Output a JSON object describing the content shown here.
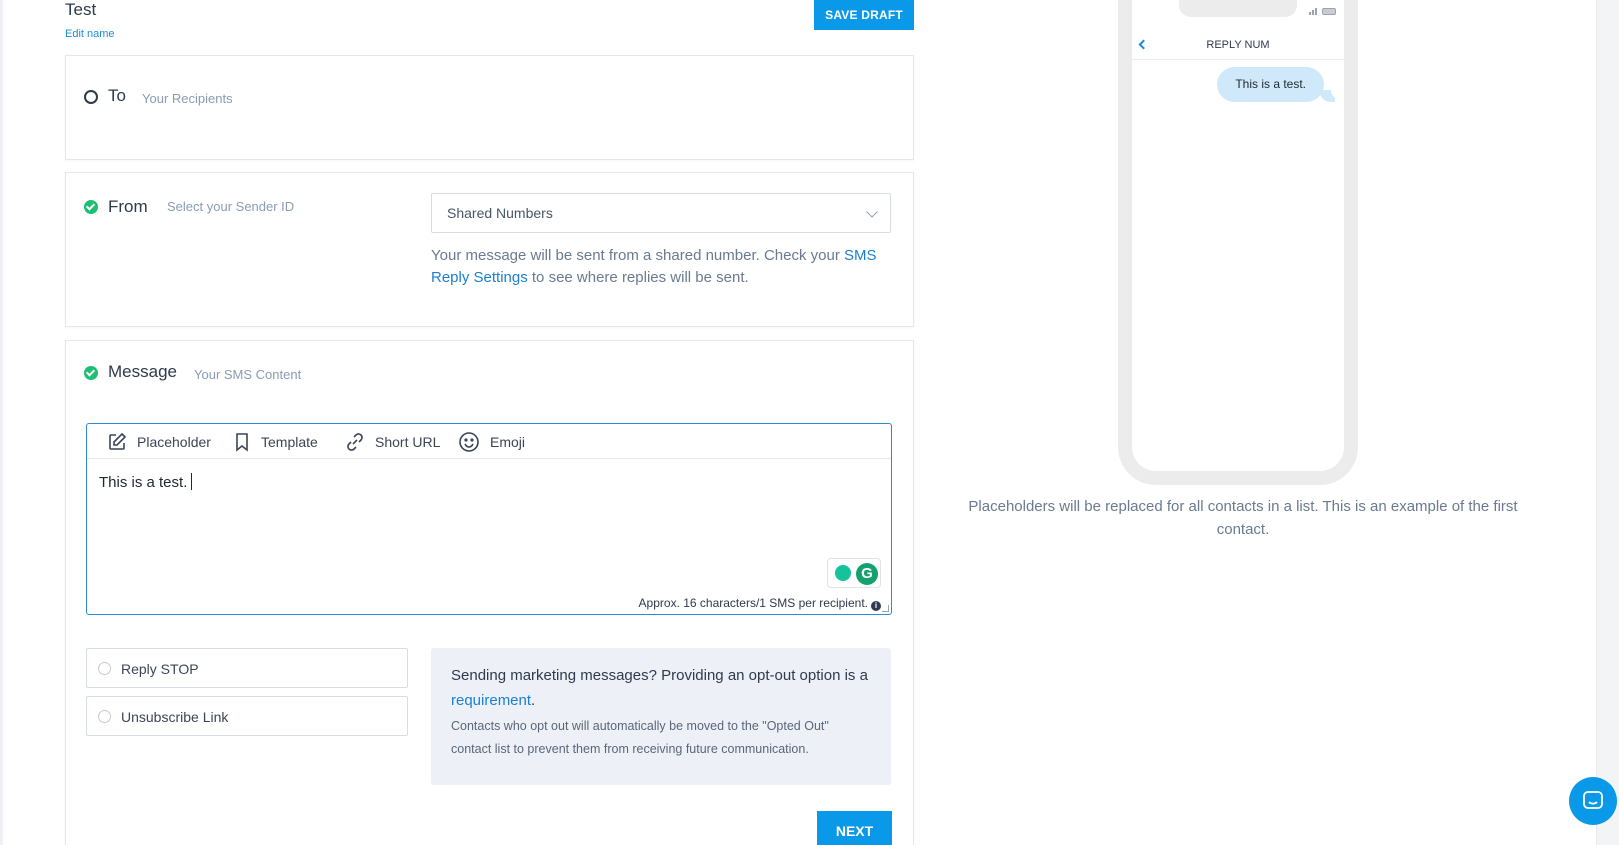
{
  "header": {
    "campaign_name": "Test",
    "edit_name_label": "Edit name",
    "save_draft_label": "SAVE DRAFT"
  },
  "to_section": {
    "title": "To",
    "subtitle": "Your Recipients"
  },
  "from_section": {
    "title": "From",
    "subtitle": "Select your Sender ID",
    "sender_select": {
      "selected": "Shared Numbers"
    },
    "note_before_link": "Your message will be sent from a shared number. Check your ",
    "note_link": "SMS Reply Settings",
    "note_after_link": " to see where replies will be sent."
  },
  "message_section": {
    "title": "Message",
    "subtitle": "Your SMS Content",
    "toolbar": {
      "placeholder_label": "Placeholder",
      "template_label": "Template",
      "short_url_label": "Short URL",
      "emoji_label": "Emoji"
    },
    "message_text": "This is a test.",
    "char_count": "Approx. 16 characters/1 SMS per recipient.",
    "options": {
      "reply_stop_label": "Reply STOP",
      "unsubscribe_link_label": "Unsubscribe Link"
    },
    "optout_info": {
      "heading_before_link": "Sending marketing messages? Providing an opt-out option is a ",
      "heading_link": "requirement",
      "heading_after_link": ".",
      "body": "Contacts who opt out will automatically be moved to the \"Opted Out\" contact list to prevent them from receiving future communication."
    },
    "next_label": "NEXT"
  },
  "preview": {
    "header_title": "REPLY NUM",
    "bubble_text": "This is a test.",
    "note": "Placeholders will be replaced for all contacts in a list. This is an example of the first contact."
  },
  "colors": {
    "accent": "#0a99e8",
    "link": "#1b7fd0",
    "success": "#1dbf73",
    "bubble": "#cfe9fb"
  },
  "icons": {
    "placeholder": "edit-icon",
    "template": "bookmark-icon",
    "short_url": "link-icon",
    "emoji": "smiley-icon",
    "chat": "chat-icon"
  }
}
